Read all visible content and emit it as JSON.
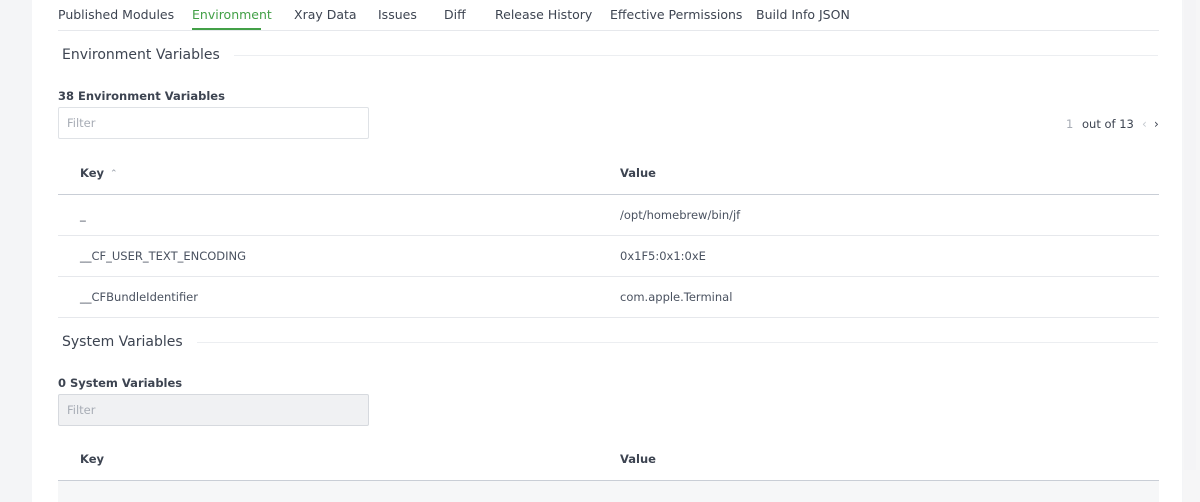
{
  "tabs": [
    {
      "label": "Published Modules",
      "active": false
    },
    {
      "label": "Environment",
      "active": true
    },
    {
      "label": "Xray Data",
      "active": false
    },
    {
      "label": "Issues",
      "active": false
    },
    {
      "label": "Diff",
      "active": false
    },
    {
      "label": "Release History",
      "active": false
    },
    {
      "label": "Effective Permissions",
      "active": false
    },
    {
      "label": "Build Info JSON",
      "active": false
    }
  ],
  "colors": {
    "accent": "#43a047",
    "text": "#3d4451",
    "muted": "#a7acb5"
  },
  "environment": {
    "section_title": "Environment Variables",
    "count_label": "38 Environment Variables",
    "filter_placeholder": "Filter",
    "pagination": {
      "current_page": "1",
      "total_label": "out of 13",
      "prev_icon": "chevron-left-icon",
      "next_icon": "chevron-right-icon"
    },
    "columns": {
      "key": "Key",
      "value": "Value",
      "sort_icon": "sort-ascending-icon"
    },
    "rows": [
      {
        "key": "_",
        "value": "/opt/homebrew/bin/jf"
      },
      {
        "key": "__CF_USER_TEXT_ENCODING",
        "value": "0x1F5:0x1:0xE"
      },
      {
        "key": "__CFBundleIdentifier",
        "value": "com.apple.Terminal"
      }
    ]
  },
  "system": {
    "section_title": "System Variables",
    "count_label": "0 System Variables",
    "filter_placeholder": "Filter",
    "columns": {
      "key": "Key",
      "value": "Value"
    }
  }
}
